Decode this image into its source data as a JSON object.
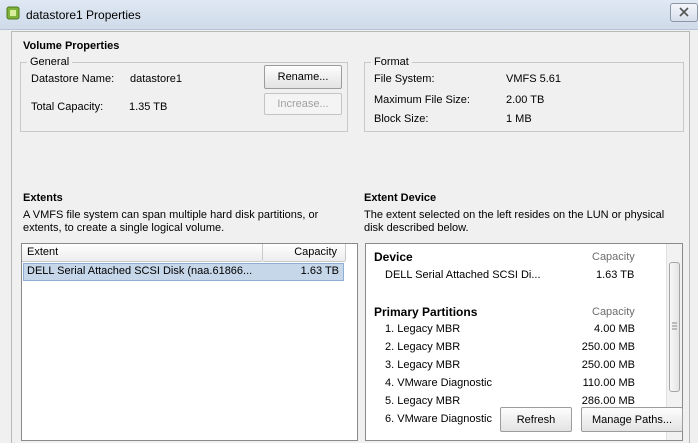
{
  "window": {
    "title": "datastore1 Properties"
  },
  "volume_properties": {
    "heading": "Volume Properties",
    "general": {
      "legend": "General",
      "datastore_name_label": "Datastore Name:",
      "datastore_name_value": "datastore1",
      "total_capacity_label": "Total Capacity:",
      "total_capacity_value": "1.35 TB",
      "rename_button": "Rename...",
      "increase_button": "Increase..."
    },
    "format": {
      "legend": "Format",
      "file_system_label": "File System:",
      "file_system_value": "VMFS 5.61",
      "max_file_size_label": "Maximum File Size:",
      "max_file_size_value": "2.00 TB",
      "block_size_label": "Block Size:",
      "block_size_value": "1 MB"
    }
  },
  "extents": {
    "heading": "Extents",
    "description_line1": "A VMFS file system can span multiple hard disk partitions, or",
    "description_line2": "extents, to create a single logical volume.",
    "columns": {
      "extent": "Extent",
      "capacity": "Capacity"
    },
    "rows": [
      {
        "extent": "DELL Serial Attached SCSI Disk (naa.61866...",
        "capacity": "1.63 TB"
      }
    ]
  },
  "extent_device": {
    "heading": "Extent Device",
    "description_line1": "The extent selected on the left resides on the LUN or physical",
    "description_line2": "disk described below.",
    "device_heading": "Device",
    "capacity_heading": "Capacity",
    "device_name": "DELL Serial Attached SCSI Di...",
    "device_capacity": "1.63 TB",
    "partitions_heading": "Primary Partitions",
    "partitions_capacity_heading": "Capacity",
    "partitions": [
      {
        "name": "1. Legacy MBR",
        "size": "4.00 MB"
      },
      {
        "name": "2. Legacy MBR",
        "size": "250.00 MB"
      },
      {
        "name": "3. Legacy MBR",
        "size": "250.00 MB"
      },
      {
        "name": "4. VMware Diagnostic",
        "size": "110.00 MB"
      },
      {
        "name": "5. Legacy MBR",
        "size": "286.00 MB"
      },
      {
        "name": "6. VMware Diagnostic",
        "size": ""
      }
    ],
    "refresh_button": "Refresh",
    "manage_paths_button": "Manage Paths..."
  }
}
